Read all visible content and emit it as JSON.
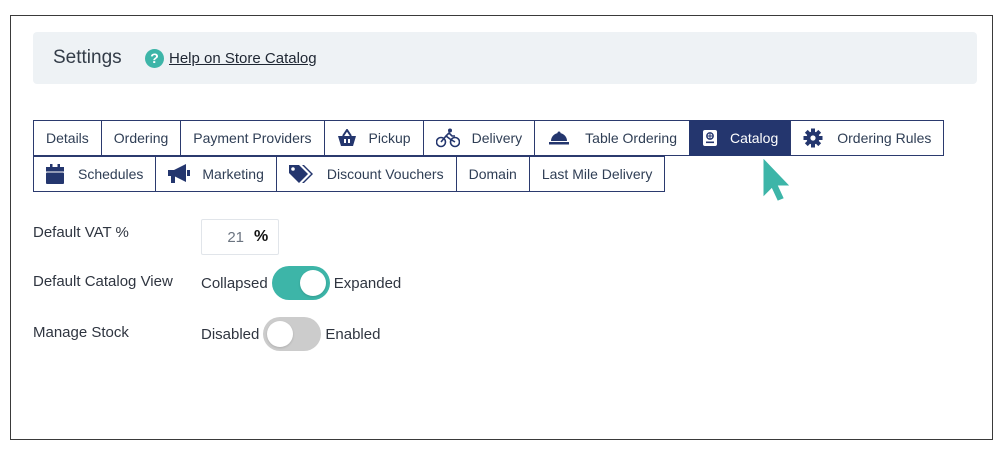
{
  "header": {
    "title": "Settings",
    "help_icon": "?",
    "help_label": "Help on Store Catalog"
  },
  "tabs_row1": [
    {
      "label": "Details",
      "icon": ""
    },
    {
      "label": "Ordering",
      "icon": ""
    },
    {
      "label": "Payment Providers",
      "icon": ""
    },
    {
      "label": "Pickup",
      "icon": "basket-icon"
    },
    {
      "label": "Delivery",
      "icon": "bicycle-icon"
    },
    {
      "label": "Table Ordering",
      "icon": "cloche-icon"
    },
    {
      "label": "Catalog",
      "icon": "catalog-book-icon",
      "active": true
    },
    {
      "label": "Ordering Rules",
      "icon": "gear-icon"
    }
  ],
  "tabs_row2": [
    {
      "label": "Schedules",
      "icon": "calendar-icon"
    },
    {
      "label": "Marketing",
      "icon": "megaphone-icon"
    },
    {
      "label": "Discount Vouchers",
      "icon": "tag-icon"
    },
    {
      "label": "Domain",
      "icon": ""
    },
    {
      "label": "Last Mile Delivery",
      "icon": ""
    }
  ],
  "fields": {
    "vat_label": "Default VAT %",
    "vat_value": "21",
    "vat_unit": "%",
    "catalog_view_label": "Default Catalog View",
    "catalog_view_off": "Collapsed",
    "catalog_view_on": "Expanded",
    "catalog_view_state": "on",
    "stock_label": "Manage Stock",
    "stock_off": "Disabled",
    "stock_on": "Enabled",
    "stock_state": "off"
  },
  "colors": {
    "active_tab": "#24366e",
    "accent": "#3db5a8",
    "toggle_off": "#cccccc"
  }
}
